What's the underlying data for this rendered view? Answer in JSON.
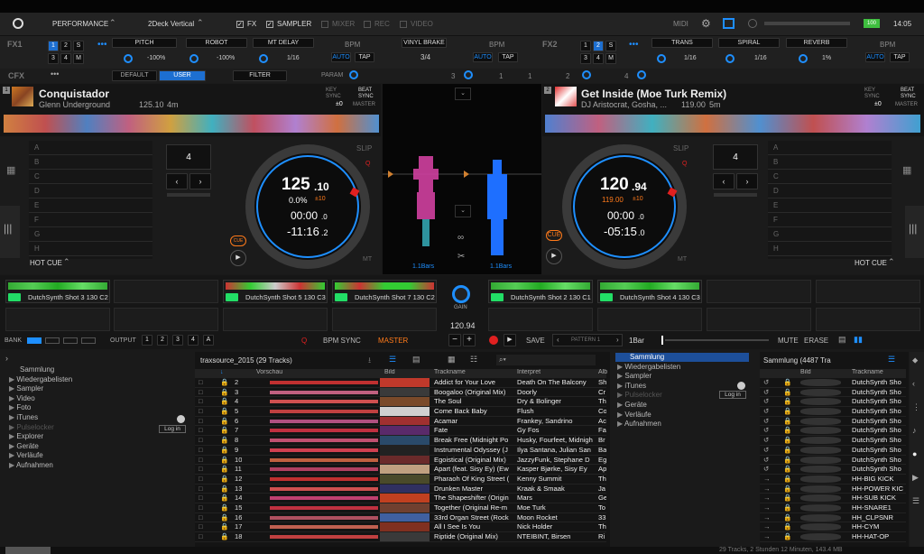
{
  "menubar": {
    "mode": "PERFORMANCE",
    "layout": "2Deck Vertical",
    "fx": "FX",
    "sampler": "SAMPLER",
    "mixer": "MIXER",
    "rec": "REC",
    "video": "VIDEO",
    "midi": "MIDI",
    "battery": "100",
    "time": "14:05"
  },
  "fx1": {
    "label": "FX1",
    "nums": [
      "1",
      "2",
      "S",
      "3",
      "4",
      "M"
    ],
    "slots": [
      {
        "name": "PITCH",
        "val": "-100%"
      },
      {
        "name": "ROBOT",
        "val": "-100%"
      },
      {
        "name": "MT DELAY",
        "val": "1/16"
      }
    ],
    "bpm": "BPM",
    "auto": "AUTO",
    "tap": "TAP"
  },
  "center_fx": {
    "name": "VINYL BRAKE",
    "val": "3/4",
    "bpm": "BPM",
    "auto": "AUTO",
    "tap": "TAP"
  },
  "fx2": {
    "label": "FX2",
    "nums": [
      "1",
      "2",
      "S",
      "3",
      "4",
      "M"
    ],
    "slots": [
      {
        "name": "TRANS",
        "val": "1/16"
      },
      {
        "name": "SPIRAL",
        "val": "1/16"
      },
      {
        "name": "REVERB",
        "val": "1%"
      }
    ],
    "bpm": "BPM",
    "auto": "AUTO",
    "tap": "TAP"
  },
  "cfx": {
    "label": "CFX",
    "default": "DEFAULT",
    "user": "USER",
    "filter": "FILTER",
    "param": "PARAM",
    "marks": [
      "3",
      "1",
      "1",
      "2",
      "4"
    ]
  },
  "deck1": {
    "num": "1",
    "title": "Conquistador",
    "artist": "Glenn Underground",
    "bpm": "125.10",
    "len": "4m",
    "key": "KEY",
    "keysync": "SYNC",
    "keyval": "±0",
    "beat": "BEAT",
    "beatsync": "SYNC",
    "master": "MASTER",
    "bpm_big": "125",
    "bpm_dec": ".10",
    "pitch": "0.0%",
    "range": "±10",
    "elapsed": "00:00",
    "elapsed_dec": ".0",
    "remain": "-11:16",
    "remain_dec": ".2",
    "slip": "SLIP",
    "q": "Q",
    "mt": "MT",
    "cue": "CUE",
    "hotcue": "HOT CUE",
    "loop": "4",
    "cues": [
      "A",
      "B",
      "C",
      "D",
      "E",
      "F",
      "G",
      "H"
    ],
    "bars": "1.1Bars"
  },
  "deck2": {
    "num": "2",
    "title": "Get Inside (Moe Turk Remix)",
    "artist": "DJ Aristocrat, Gosha, ...",
    "bpm": "119.00",
    "len": "5m",
    "key": "KEY",
    "keysync": "SYNC",
    "keyval": "±0",
    "beat": "BEAT",
    "beatsync": "SYNC",
    "master": "MASTER",
    "bpm_big": "120",
    "bpm_dec": ".94",
    "pitch": "119.00",
    "range": "±10",
    "elapsed": "00:00",
    "elapsed_dec": ".0",
    "remain": "-05:15",
    "remain_dec": ".0",
    "slip": "SLIP",
    "q": "Q",
    "mt": "MT",
    "cue": "CUE",
    "hotcue": "HOT CUE",
    "loop": "4",
    "cues": [
      "A",
      "B",
      "C",
      "D",
      "E",
      "F",
      "G",
      "H"
    ],
    "bars": "1.1Bars"
  },
  "sampler": {
    "slots": [
      "DutchSynth Shot 3 130 C2",
      "DutchSynth Shot 5 130 C3",
      "DutchSynth Shot 7 130 C2",
      "DutchSynth Shot 2 130 C1",
      "DutchSynth Shot 4 130 C3"
    ],
    "gain": "GAIN",
    "bpm": "120.94",
    "bank": "BANK",
    "output": "OUTPUT",
    "outs": [
      "1",
      "2",
      "3",
      "4",
      "A"
    ],
    "q": "Q",
    "bpmsync": "BPM SYNC",
    "master": "MASTER",
    "save": "SAVE",
    "pattern": "PATTERN 1",
    "bar": "1Bar",
    "mute": "MUTE",
    "erase": "ERASE"
  },
  "browser_left": {
    "items": [
      "Sammlung",
      "Wiedergabelisten",
      "Sampler",
      "Video",
      "Foto",
      "iTunes",
      "Pulselocker",
      "Explorer",
      "Geräte",
      "Verläufe",
      "Aufnahmen"
    ],
    "login": "Log in"
  },
  "list1": {
    "title": "traxsource_2015 (29 Tracks)",
    "cols": [
      "Vorschau",
      "Bild",
      "Trackname",
      "Interpret",
      "Alb"
    ],
    "rows": [
      {
        "n": "2",
        "name": "Addict for Your Love",
        "artist": "Death On The Balcony",
        "alb": "Sh"
      },
      {
        "n": "3",
        "name": "Boogaloo (Original Mix)",
        "artist": "Doorly",
        "alb": "Cr"
      },
      {
        "n": "4",
        "name": "The Soul",
        "artist": "Dry & Bolinger",
        "alb": "Th"
      },
      {
        "n": "5",
        "name": "Come Back Baby",
        "artist": "Flush",
        "alb": "Co"
      },
      {
        "n": "6",
        "name": "Acamar",
        "artist": "Frankey, Sandrino",
        "alb": "Ac"
      },
      {
        "n": "7",
        "name": "Fate",
        "artist": "Gy Fos",
        "alb": "Fa"
      },
      {
        "n": "8",
        "name": "Break Free (Midnight Po",
        "artist": "Husky, Fourfeet, Midnigh",
        "alb": "Br"
      },
      {
        "n": "9",
        "name": "Instrumental Odyssey (J",
        "artist": "Ilya Santana, Julian San",
        "alb": "Ba"
      },
      {
        "n": "10",
        "name": "Egoistical (Original Mix)",
        "artist": "JazzyFunk, Stephane D",
        "alb": "Eg"
      },
      {
        "n": "11",
        "name": "Apart (feat. Sisy Ey) (Ew",
        "artist": "Kasper Bjørke, Sisy Ey",
        "alb": "Ap"
      },
      {
        "n": "12",
        "name": "Pharaoh Of King Street (",
        "artist": "Kenny Summit",
        "alb": "Th"
      },
      {
        "n": "13",
        "name": "Drunken Master",
        "artist": "Kraak & Smaak",
        "alb": "Ja"
      },
      {
        "n": "14",
        "name": "The Shapeshifter (Origin",
        "artist": "Mars",
        "alb": "Ge"
      },
      {
        "n": "15",
        "name": "Together (Original Re-m",
        "artist": "Moe Turk",
        "alb": "To"
      },
      {
        "n": "16",
        "name": "33rd Organ Street (Rock",
        "artist": "Moon Rocket",
        "alb": "33"
      },
      {
        "n": "17",
        "name": "All I See Is You",
        "artist": "Nick Holder",
        "alb": "Th"
      },
      {
        "n": "18",
        "name": "Riptide (Original Mix)",
        "artist": "NTEIBINT, Birsen",
        "alb": "Ri"
      }
    ]
  },
  "browser_mid": {
    "items": [
      "Sammlung",
      "Wiedergabelisten",
      "Sampler",
      "iTunes",
      "Pulselocker",
      "Geräte",
      "Verläufe",
      "Aufnahmen"
    ],
    "login": "Log in"
  },
  "list2": {
    "title": "Sammlung (4487 Tra",
    "cols": [
      "Bild",
      "Trackname"
    ],
    "rows": [
      "DutchSynth Sho",
      "DutchSynth Sho",
      "DutchSynth Sho",
      "DutchSynth Sho",
      "DutchSynth Sho",
      "DutchSynth Sho",
      "DutchSynth Sho",
      "DutchSynth Sho",
      "DutchSynth Sho",
      "DutchSynth Sho",
      "HH-BIG KICK",
      "HH-POWER KIC",
      "HH-SUB KICK",
      "HH-SNARE1",
      "HH_CLPSNR",
      "HH-CYM",
      "HH-HAT-OP"
    ]
  },
  "footer": {
    "status": "29 Tracks, 2 Stunden 12 Minuten, 143.4 MB"
  },
  "colors": {
    "accent": "#1e8fff",
    "orange": "#ff7a1a",
    "red": "#e02020"
  }
}
